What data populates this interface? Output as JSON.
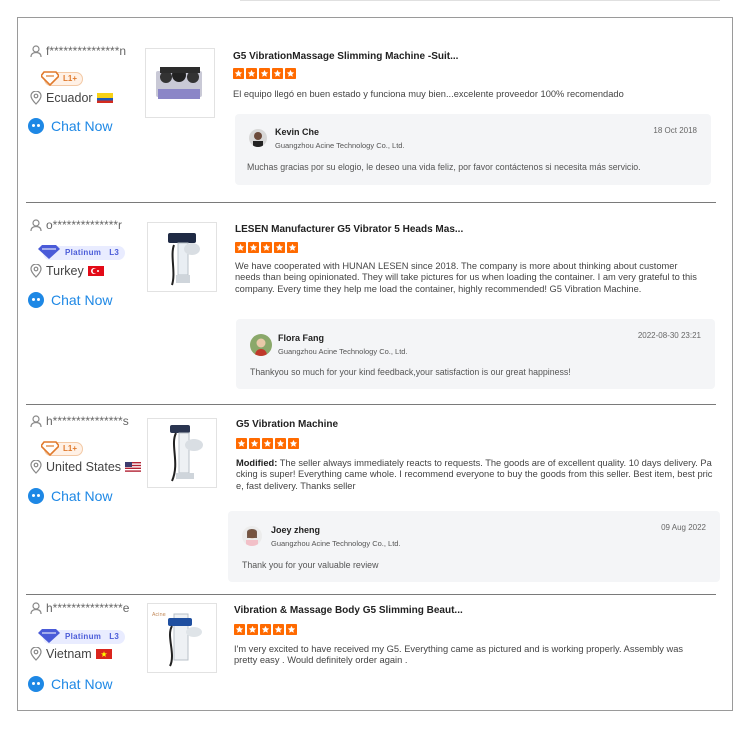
{
  "colors": {
    "accent": "#1e88e5",
    "star": "#ff6a00",
    "reply_bg": "#f4f5f7",
    "l1_badge": "#e07a2d",
    "platinum_badge": "#4a5bd8"
  },
  "reviews": [
    {
      "user": "f***************n",
      "badge": {
        "type": "L1+",
        "label": "L1+"
      },
      "country": "Ecuador",
      "country_flag_icon": "ecuador-flag-icon",
      "chat_label": "Chat Now",
      "product_title": "G5 VibrationMassage  Slimming Machine -Suit...",
      "rating": 5,
      "text": "El equipo llegó en buen estado y funciona muy bien...excelente proveedor 100% recomendado",
      "reply": {
        "name": "Kevin Che",
        "company": "Guangzhou Acine Technology Co., Ltd.",
        "date": "18 Oct 2018",
        "message": "Muchas gracias por su elogio, le deseo una vida feliz, por favor contáctenos si necesita más servicio."
      }
    },
    {
      "user": "o**************r",
      "badge": {
        "type": "Platinum",
        "label": "Platinum",
        "level": "L3"
      },
      "country": "Turkey",
      "country_flag_icon": "turkey-flag-icon",
      "chat_label": "Chat Now",
      "product_title": "LESEN Manufacturer G5 Vibrator 5 Heads Mas...",
      "rating": 5,
      "text": "We have cooperated with HUNAN LESEN since 2018. The company is more about thinking about customer needs than being opinionated. They will take pictures for us when loading the container. I am very grateful to this company. Every time they help me load the container, highly recommended! G5 Vibration Machine.",
      "reply": {
        "name": "Flora Fang",
        "company": "Guangzhou Acine Technology Co., Ltd.",
        "date": "2022-08-30 23:21",
        "message": "Thankyou so much for your kind feedback,your satisfaction is our great happiness!"
      }
    },
    {
      "user": "h***************s",
      "badge": {
        "type": "L1+",
        "label": "L1+"
      },
      "country": "United States",
      "country_flag_icon": "us-flag-icon",
      "chat_label": "Chat Now",
      "product_title": "G5 Vibration Machine",
      "rating": 5,
      "text_prefix": "Modified:",
      "text": "The seller always immediately reacts to requests. The goods are of excellent quality. 10 days delivery. Packing is super! Everything came whole. I recommend everyone to buy the goods from this seller. Best item, best price, fast delivery. Thanks seller",
      "reply": {
        "name": "Joey zheng",
        "company": "Guangzhou Acine Technology Co., Ltd.",
        "date": "09 Aug 2022",
        "message": "Thank you for your valuable review"
      }
    },
    {
      "user": "h***************e",
      "badge": {
        "type": "Platinum",
        "label": "Platinum",
        "level": "L3"
      },
      "country": "Vietnam",
      "country_flag_icon": "vietnam-flag-icon",
      "chat_label": "Chat Now",
      "product_title": "Vibration & Massage Body G5 Slimming Beaut...",
      "rating": 5,
      "text": "I'm very excited to have received my G5. Everything came as pictured and is working properly. Assembly was pretty easy . Would definitely order again ."
    }
  ]
}
